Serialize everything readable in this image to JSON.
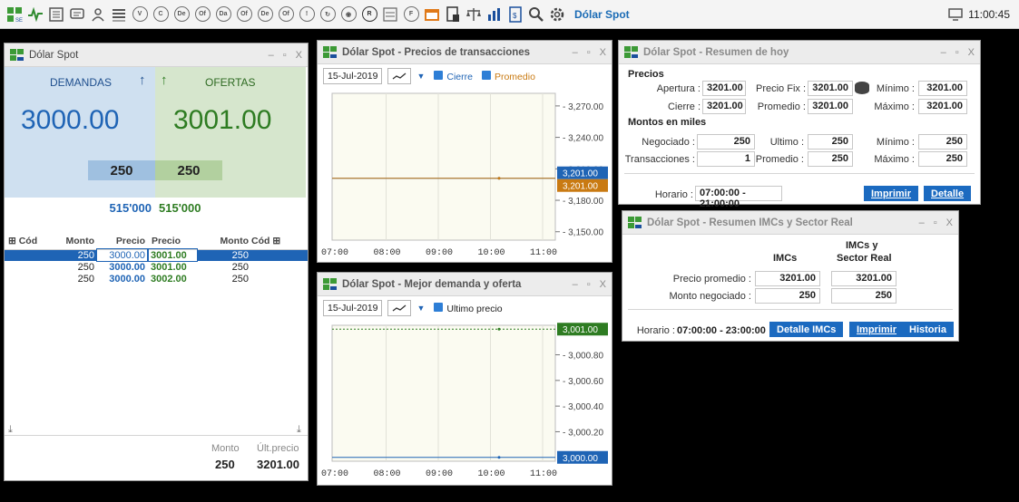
{
  "toolbar": {
    "title": "Dólar Spot",
    "clock": "11:00:45",
    "circle_icons": [
      "V",
      "C",
      "De",
      "Of",
      "Da",
      "Of",
      "De",
      "Of",
      "!",
      "",
      "",
      "R",
      "",
      "F"
    ]
  },
  "spot": {
    "title": "Dólar Spot",
    "demand_label": "DEMANDAS",
    "offer_label": "OFERTAS",
    "best_bid": "3000.00",
    "best_ask": "3001.00",
    "bid_qty": "250",
    "ask_qty": "250",
    "bid_total": "515'000",
    "ask_total": "515'000",
    "headers": [
      "Cód",
      "Monto",
      "Precio",
      "Precio",
      "Monto",
      "Cód"
    ],
    "rows": [
      {
        "bid_monto": "250",
        "bid_precio": "3000.00",
        "ask_precio": "3001.00",
        "ask_monto": "250"
      },
      {
        "bid_monto": "250",
        "bid_precio": "3000.00",
        "ask_precio": "3001.00",
        "ask_monto": "250"
      },
      {
        "bid_monto": "250",
        "bid_precio": "3000.00",
        "ask_precio": "3002.00",
        "ask_monto": "250"
      }
    ],
    "footer_monto_label": "Monto",
    "footer_price_label": "Últ.precio",
    "footer_monto": "250",
    "footer_price": "3201.00"
  },
  "chart1": {
    "title": "Dólar Spot - Precios de transacciones",
    "date": "15-Jul-2019",
    "check1": "Cierre",
    "check2": "Promedio",
    "cierre_tag": "3,201.00",
    "promedio_tag": "3,201.00"
  },
  "chart2": {
    "title": "Dólar Spot - Mejor demanda y oferta",
    "date": "15-Jul-2019",
    "check1": "Ultimo precio",
    "ask_tag": "3,001.00",
    "bid_tag": "3,000.00"
  },
  "chart_data": [
    {
      "type": "line",
      "title": "Dólar Spot - Precios de transacciones",
      "x_ticks": [
        "07:00",
        "08:00",
        "09:00",
        "10:00",
        "11:00"
      ],
      "y_ticks": [
        "3,270.00",
        "3,240.00",
        "3,210.00",
        "3,180.00",
        "3,150.00"
      ],
      "series": [
        {
          "name": "Cierre",
          "color": "#1f64b5",
          "value": 3201.0
        },
        {
          "name": "Promedio",
          "color": "#c97a12",
          "value": 3201.0
        }
      ]
    },
    {
      "type": "line",
      "title": "Dólar Spot - Mejor demanda y oferta",
      "x_ticks": [
        "07:00",
        "08:00",
        "09:00",
        "10:00",
        "11:00"
      ],
      "y_ticks": [
        "3,000.80",
        "3,000.60",
        "3,000.40",
        "3,000.20"
      ],
      "series": [
        {
          "name": "Oferta",
          "color": "#2e7c22",
          "value": 3001.0
        },
        {
          "name": "Demanda",
          "color": "#1f64b5",
          "value": 3000.0
        }
      ]
    }
  ],
  "resumen": {
    "title": "Dólar Spot - Resumen de hoy",
    "sec_precios": "Precios",
    "sec_montos": "Montos en miles",
    "apertura_label": "Apertura :",
    "apertura": "3201.00",
    "fix_label": "Precio Fix :",
    "fix": "3201.00",
    "min_label": "Mínimo :",
    "min": "3201.00",
    "cierre_label": "Cierre :",
    "cierre": "3201.00",
    "prom_label": "Promedio :",
    "prom": "3201.00",
    "max_label": "Máximo :",
    "max": "3201.00",
    "neg_label": "Negociado :",
    "neg": "250",
    "ult_label": "Ultimo :",
    "ult": "250",
    "mmin_label": "Mínimo :",
    "mmin": "250",
    "trans_label": "Transacciones :",
    "trans": "1",
    "mprom_label": "Promedio :",
    "mprom": "250",
    "mmax_label": "Máximo :",
    "mmax": "250",
    "horario_label": "Horario :",
    "horario": "07:00:00 - 21:00:00",
    "btn_print": "Imprimir",
    "btn_detail": "Detalle"
  },
  "imc": {
    "title": "Dólar Spot - Resumen IMCs y Sector Real",
    "col1": "IMCs",
    "col2a": "IMCs y",
    "col2b": "Sector Real",
    "row1_label": "Precio promedio :",
    "row1_a": "3201.00",
    "row1_b": "3201.00",
    "row2_label": "Monto negociado :",
    "row2_a": "250",
    "row2_b": "250",
    "horario_label": "Horario :",
    "horario": "07:00:00 - 23:00:00",
    "btn1": "Detalle IMCs",
    "btn2": "Imprimir",
    "btn3": "Historia"
  }
}
